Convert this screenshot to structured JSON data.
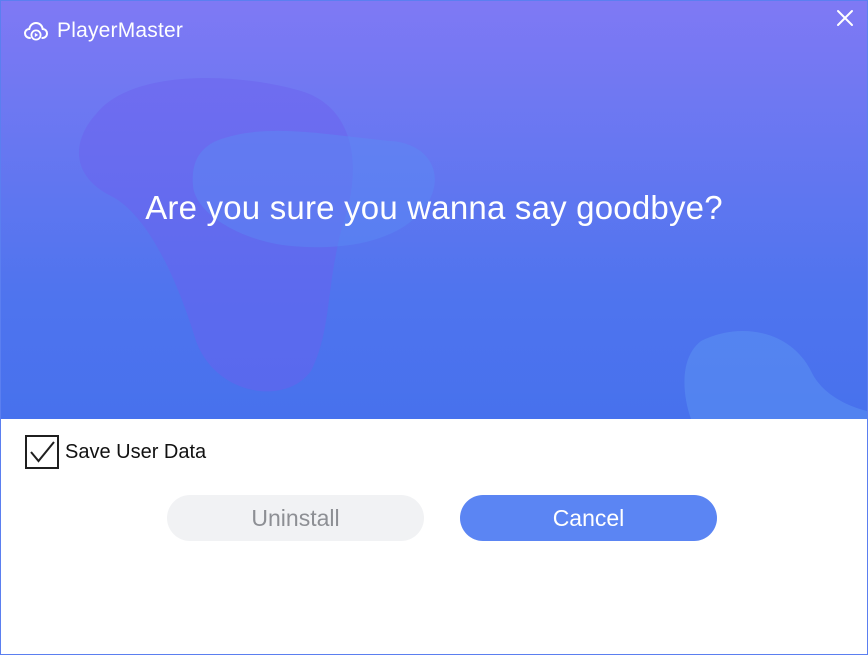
{
  "window": {
    "title": "PlayerMaster",
    "app_icon": "cloud-play-icon",
    "close_icon": "close-icon"
  },
  "banner": {
    "headline": "Are you sure you wanna say goodbye?"
  },
  "options": {
    "save_user_data": {
      "label": "Save User Data",
      "checked": true
    }
  },
  "buttons": {
    "uninstall": "Uninstall",
    "cancel": "Cancel"
  },
  "colors": {
    "banner_top": "#7f79f4",
    "banner_bottom": "#4771ed",
    "cancel_button": "#5b85f3",
    "uninstall_button": "#f1f2f4",
    "uninstall_text": "#8d8f94"
  }
}
